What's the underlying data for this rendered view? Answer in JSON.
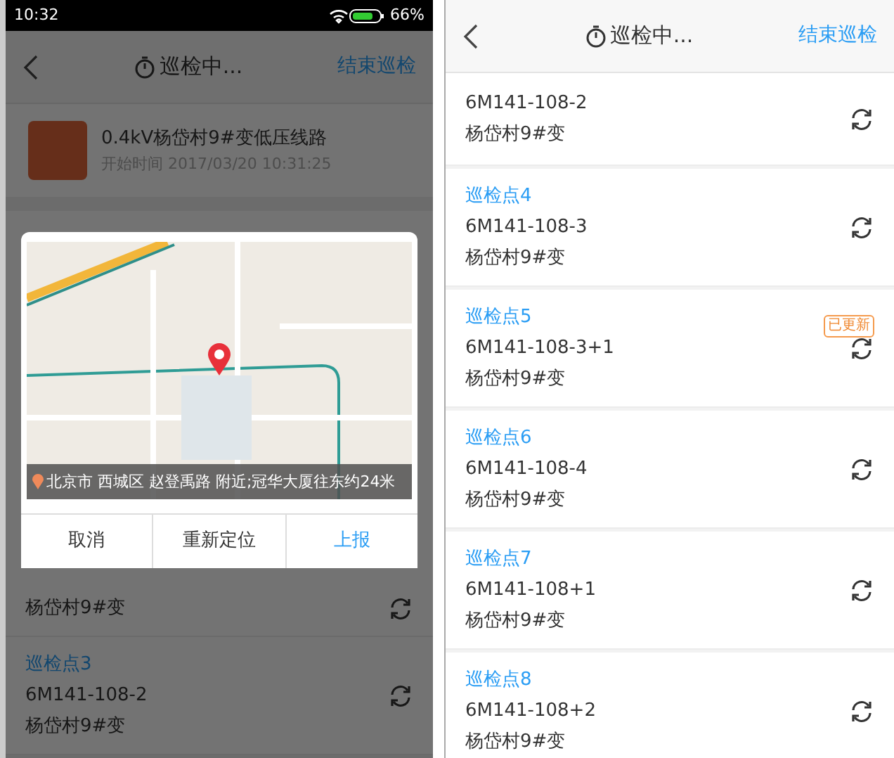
{
  "left_screen": {
    "status_bar": {
      "time": "10:32",
      "battery": "66%"
    },
    "header": {
      "title": "巡检中...",
      "action": "结束巡检"
    },
    "task": {
      "title": "0.4kV杨岱村9#变低压线路",
      "start_time": "开始时间 2017/03/20 10:31:25"
    },
    "points": [
      {
        "substation": "杨岱村9#变"
      },
      {
        "title": "巡检点3",
        "code": "6M141-108-2",
        "substation": "杨岱村9#变"
      }
    ],
    "dialog": {
      "address": "北京市 西城区 赵登禹路 附近;冠华大厦往东约24米",
      "buttons": [
        {
          "label": "取消",
          "kind": "plain"
        },
        {
          "label": "重新定位",
          "kind": "plain"
        },
        {
          "label": "上报",
          "kind": "primary"
        }
      ]
    }
  },
  "right_screen": {
    "header": {
      "title": "巡检中...",
      "action": "结束巡检"
    },
    "points": [
      {
        "code": "6M141-108-2",
        "substation": "杨岱村9#变"
      },
      {
        "title": "巡检点4",
        "code": "6M141-108-3",
        "substation": "杨岱村9#变"
      },
      {
        "title": "巡检点5",
        "code": "6M141-108-3+1",
        "substation": "杨岱村9#变",
        "badge": "已更新"
      },
      {
        "title": "巡检点6",
        "code": "6M141-108-4",
        "substation": "杨岱村9#变"
      },
      {
        "title": "巡检点7",
        "code": "6M141-108+1",
        "substation": "杨岱村9#变"
      },
      {
        "title": "巡检点8",
        "code": "6M141-108+2",
        "substation": "杨岱村9#变"
      }
    ]
  }
}
